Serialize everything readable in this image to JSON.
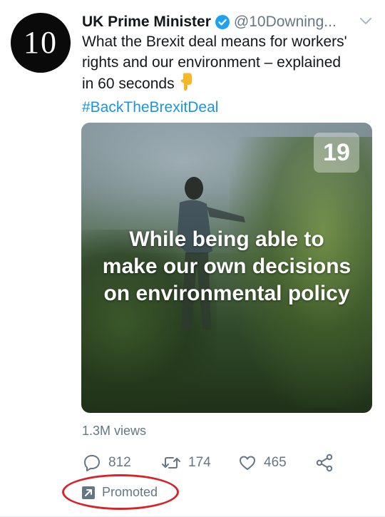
{
  "tweet": {
    "avatar_text": "10",
    "display_name": "UK Prime Minister",
    "handle": "@10Downing...",
    "text_lines": [
      "What the Brexit deal means for workers'",
      "rights and our environment – explained",
      "in 60 seconds"
    ],
    "emoji": "pointing-down-emoji",
    "hashtag": "#BackTheBrexitDeal"
  },
  "media": {
    "counter": "19",
    "caption_lines": [
      "While being able to",
      "make our own decisions",
      "on environmental policy"
    ]
  },
  "stats": {
    "views": "1.3M views"
  },
  "actions": {
    "reply_count": "812",
    "retweet_count": "174",
    "like_count": "465"
  },
  "promoted": {
    "label": "Promoted"
  },
  "colors": {
    "text": "#14171a",
    "secondary": "#657786",
    "link": "#1b95e0",
    "verified": "#1da1f2",
    "annotation": "#d9232b"
  },
  "icons": [
    "verified-badge-icon",
    "caret-down-icon",
    "reply-icon",
    "retweet-icon",
    "like-icon",
    "share-icon",
    "promoted-arrow-icon"
  ]
}
